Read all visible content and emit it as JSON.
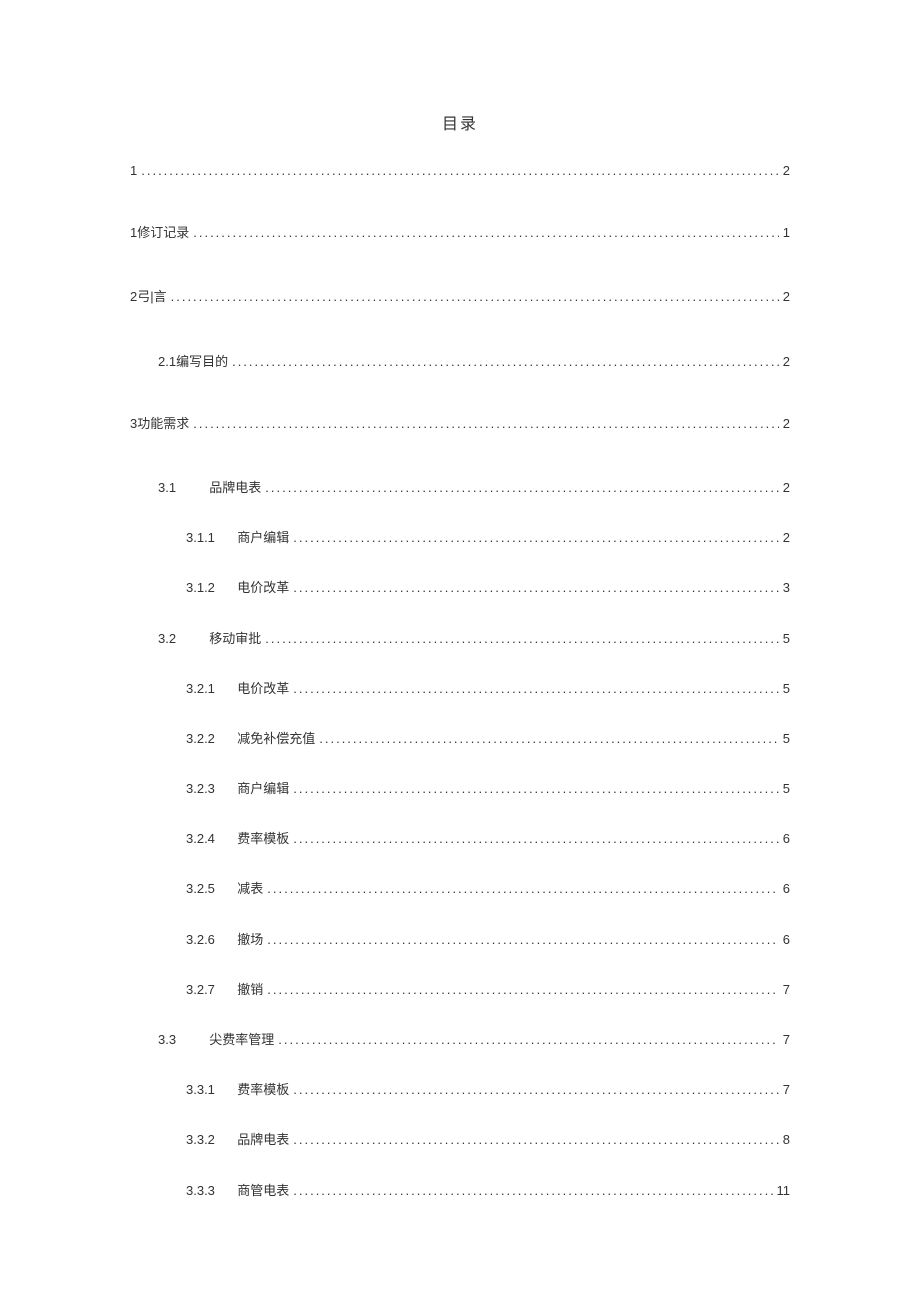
{
  "title": "目录",
  "entries": [
    {
      "class": "level-0",
      "num": "1",
      "title": "",
      "page": "2"
    },
    {
      "class": "level-0b",
      "num": "",
      "title": "1修订记录",
      "page": "1"
    },
    {
      "class": "level-0b",
      "num": "",
      "title": "2弓|言",
      "page": "2"
    },
    {
      "class": "level-1",
      "num": "",
      "title": "2.1编写目的",
      "page": "2"
    },
    {
      "class": "level-0b",
      "num": "",
      "title": "3功能需求",
      "page": "2"
    },
    {
      "class": "level-2",
      "num": "3.1",
      "title": "品牌电表",
      "page": "2"
    },
    {
      "class": "level-3",
      "num": "3.1.1",
      "title": "商户编辑",
      "page": "2"
    },
    {
      "class": "level-3",
      "num": "3.1.2",
      "title": "电价改革",
      "page": "3"
    },
    {
      "class": "level-2",
      "num": "3.2",
      "title": "移动审批",
      "page": "5"
    },
    {
      "class": "level-3",
      "num": "3.2.1",
      "title": "电价改革",
      "page": "5"
    },
    {
      "class": "level-3",
      "num": "3.2.2",
      "title": "减免补偿充值",
      "page": "5"
    },
    {
      "class": "level-3",
      "num": "3.2.3",
      "title": "商户编辑",
      "page": "5"
    },
    {
      "class": "level-3",
      "num": "3.2.4",
      "title": "费率模板",
      "page": "6"
    },
    {
      "class": "level-3",
      "num": "3.2.5",
      "title": "减表",
      "page": "6"
    },
    {
      "class": "level-3",
      "num": "3.2.6",
      "title": "撤场",
      "page": "6"
    },
    {
      "class": "level-3",
      "num": "3.2.7",
      "title": "撤销",
      "page": "7"
    },
    {
      "class": "level-2",
      "num": "3.3",
      "title": "尖费率管理",
      "page": "7"
    },
    {
      "class": "level-3",
      "num": "3.3.1",
      "title": "费率模板",
      "page": "7"
    },
    {
      "class": "level-3",
      "num": "3.3.2",
      "title": "品牌电表",
      "page": "8"
    },
    {
      "class": "level-3",
      "num": "3.3.3",
      "title": "商管电表",
      "page": "11"
    }
  ]
}
